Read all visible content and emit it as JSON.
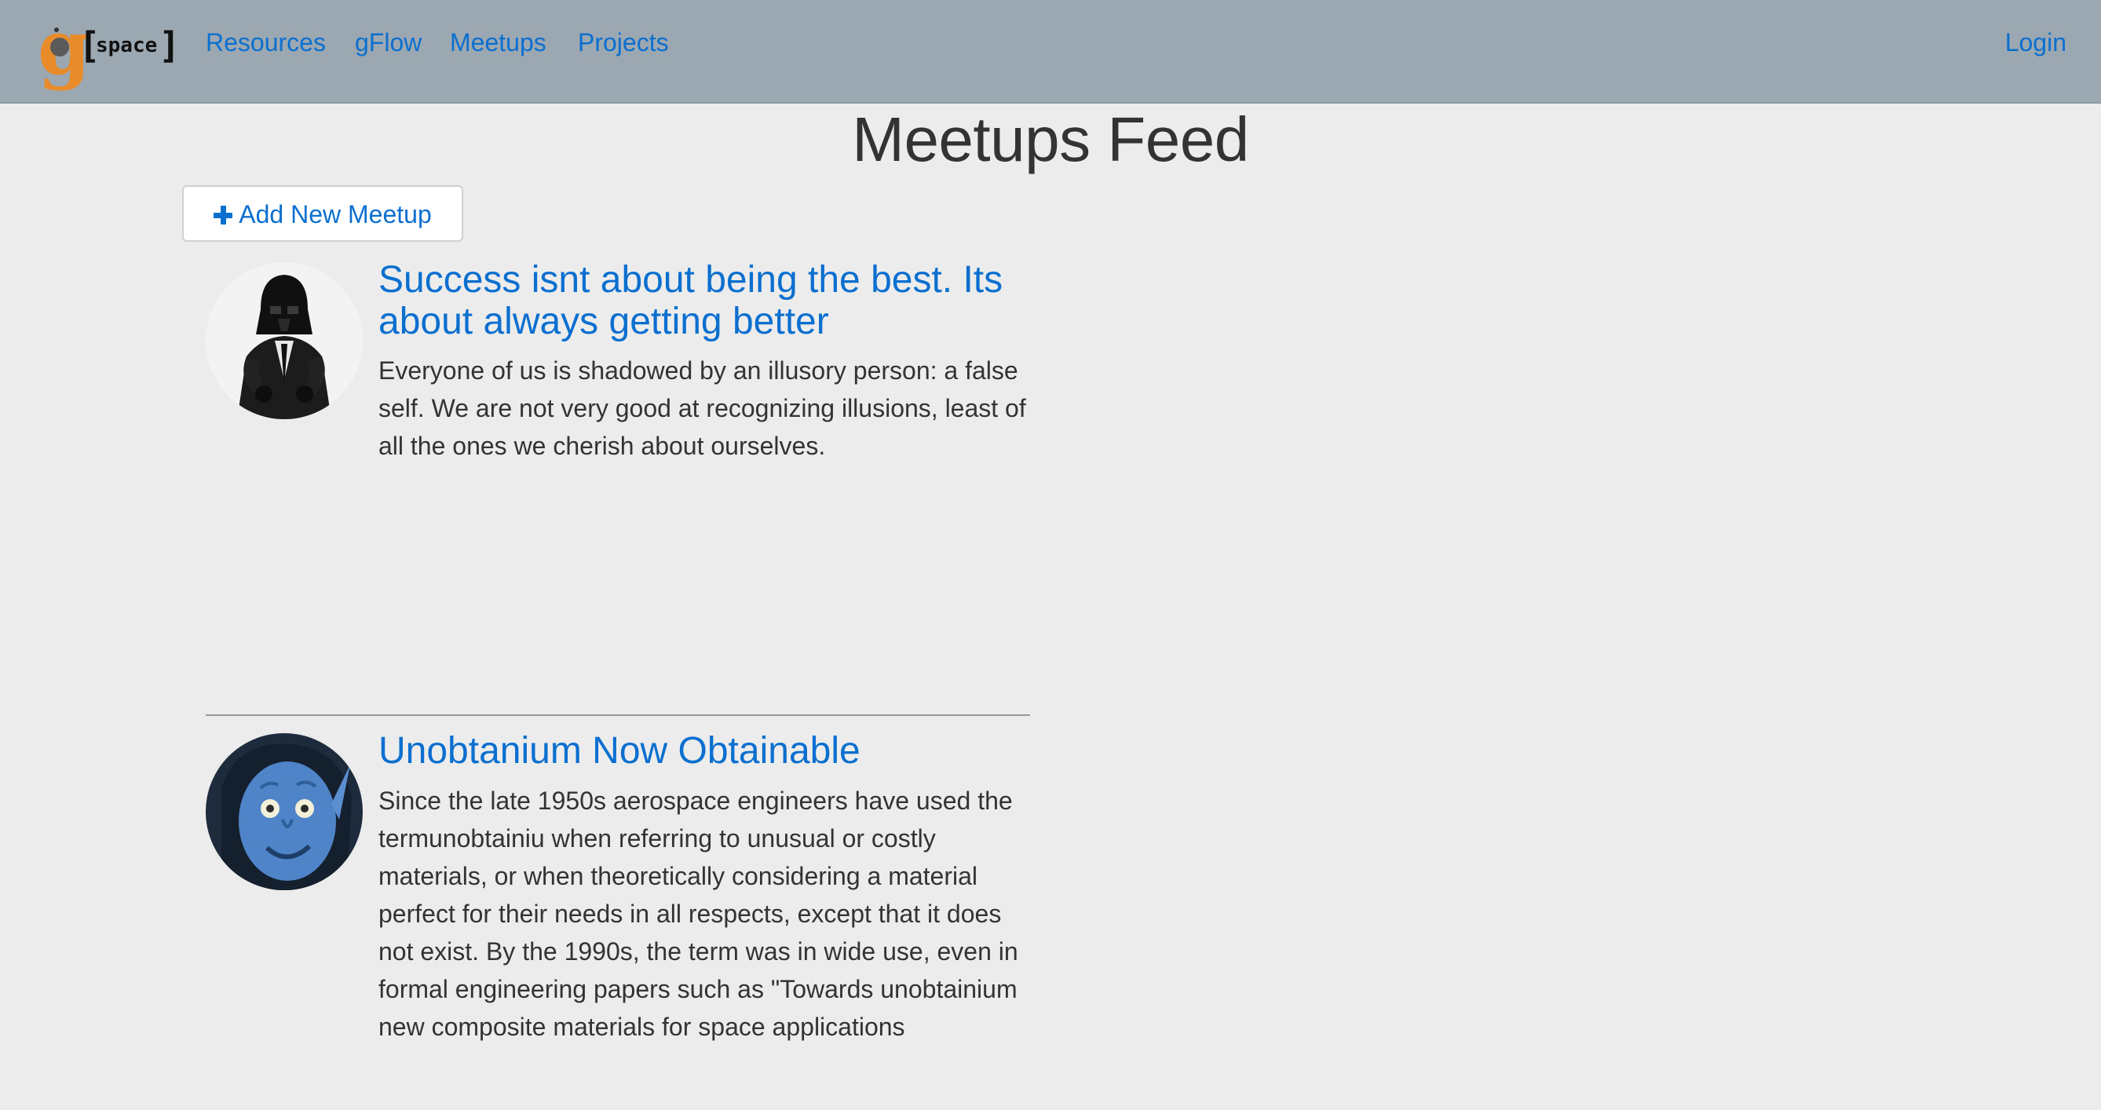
{
  "navbar": {
    "logo_letter": "g",
    "logo_text": "space",
    "links": [
      {
        "label": "Resources"
      },
      {
        "label": "gFlow"
      },
      {
        "label": "Meetups"
      },
      {
        "label": "Projects"
      }
    ],
    "login_label": "Login"
  },
  "page": {
    "title": "Meetups Feed"
  },
  "add_button": {
    "label": "Add New Meetup",
    "icon": "plus-icon"
  },
  "meetups": [
    {
      "title": "Success isnt about being the best. Its about always getting better",
      "description": "Everyone of us is shadowed by an illusory person: a false self. We are not very good at recognizing illusions, least of all the ones we cherish about ourselves.",
      "avatar": "helmeted-figure-in-suit"
    },
    {
      "title": "Unobtanium Now Obtainable",
      "description": "Since the late 1950s aerospace engineers have used the termunobtainiu when referring to unusual or costly materials, or when theoretically considering a material perfect for their needs in all respects, except that it does not exist. By the 1990s, the term was in wide use, even in formal engineering papers such as \"Towards unobtainium new composite materials for space applications",
      "avatar": "blue-skinned-face"
    }
  ],
  "colors": {
    "navbar_bg": "#9ba8b1",
    "link": "#0b6fd0",
    "page_bg": "#ececec",
    "text": "#333333",
    "logo_orange": "#e88b2a"
  }
}
